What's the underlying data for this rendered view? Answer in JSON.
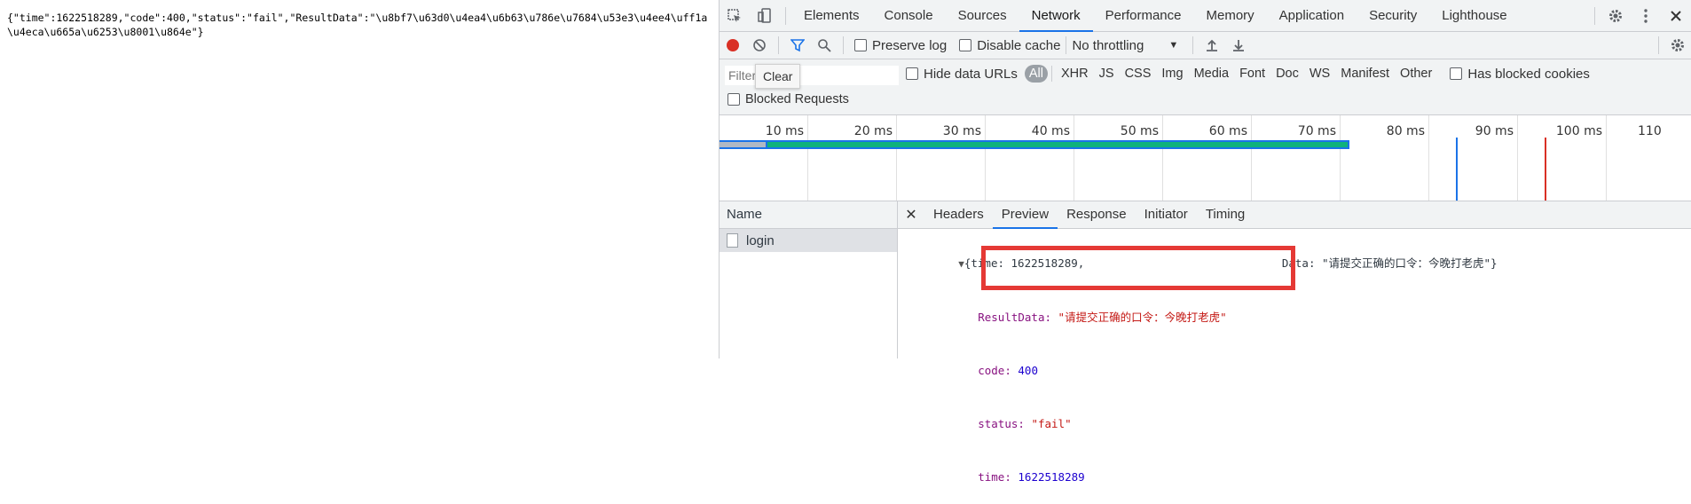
{
  "page": {
    "raw_json": "{\"time\":1622518289,\"code\":400,\"status\":\"fail\",\"ResultData\":\"\\u8bf7\\u63d0\\u4ea4\\u6b63\\u786e\\u7684\\u53e3\\u4ee4\\uff1a\\u4eca\\u665a\\u6253\\u8001\\u864e\"}"
  },
  "devtools": {
    "tabs": [
      "Elements",
      "Console",
      "Sources",
      "Network",
      "Performance",
      "Memory",
      "Application",
      "Security",
      "Lighthouse"
    ],
    "active_tab": "Network",
    "toolbar": {
      "preserve_log": "Preserve log",
      "disable_cache": "Disable cache",
      "throttling": "No throttling"
    },
    "filter": {
      "placeholder": "Filter",
      "tooltip": "Clear",
      "hide_data_urls": "Hide data URLs",
      "types": [
        "All",
        "XHR",
        "JS",
        "CSS",
        "Img",
        "Media",
        "Font",
        "Doc",
        "WS",
        "Manifest",
        "Other"
      ],
      "has_blocked_cookies": "Has blocked cookies",
      "blocked_requests": "Blocked Requests"
    },
    "timeline": {
      "ticks": [
        "10 ms",
        "20 ms",
        "30 ms",
        "40 ms",
        "50 ms",
        "60 ms",
        "70 ms",
        "80 ms",
        "90 ms",
        "100 ms",
        "110"
      ]
    },
    "requests": {
      "header": "Name",
      "items": [
        "login"
      ]
    },
    "details": {
      "tabs": [
        "Headers",
        "Preview",
        "Response",
        "Initiator",
        "Timing"
      ],
      "active_tab": "Preview",
      "summary_prefix": "{time: ",
      "summary_tail": "Data: \"请提交正确的口令：今晚打老虎\"}",
      "fields": [
        {
          "key": "ResultData",
          "value": "\"请提交正确的口令：今晚打老虎\"",
          "type": "str"
        },
        {
          "key": "code",
          "value": "400",
          "type": "num"
        },
        {
          "key": "status",
          "value": "\"fail\"",
          "type": "str"
        },
        {
          "key": "time",
          "value": "1622518289",
          "type": "num"
        }
      ]
    }
  },
  "colors": {
    "accent": "#1a73e8",
    "highlight": "#e53935",
    "record": "#d93025"
  }
}
